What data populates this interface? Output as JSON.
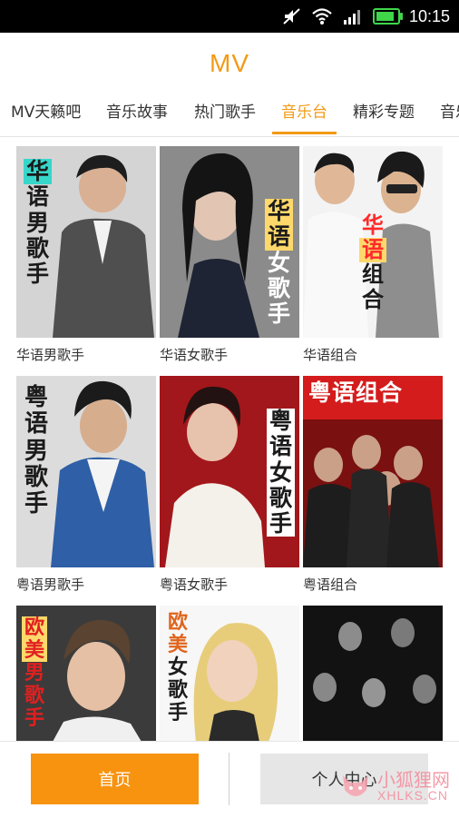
{
  "status_bar": {
    "time": "10:15",
    "icons": [
      "mute-icon",
      "wifi-icon",
      "signal-icon",
      "battery-icon"
    ],
    "battery_level": 0.9
  },
  "header": {
    "title": "MV"
  },
  "tabs": [
    {
      "label": "MV天籁吧",
      "active": false
    },
    {
      "label": "音乐故事",
      "active": false
    },
    {
      "label": "热门歌手",
      "active": false
    },
    {
      "label": "音乐台",
      "active": true
    },
    {
      "label": "精彩专题",
      "active": false
    },
    {
      "label": "音乐",
      "active": false
    }
  ],
  "grid": {
    "items": [
      {
        "label": "华语男歌手",
        "overlay": [
          "华",
          "语",
          "男",
          "歌",
          "手"
        ]
      },
      {
        "label": "华语女歌手",
        "overlay": [
          "华",
          "语",
          "女",
          "歌",
          "手"
        ]
      },
      {
        "label": "华语组合",
        "overlay": [
          "华",
          "语",
          "组",
          "合"
        ]
      },
      {
        "label": "粤语男歌手",
        "overlay": [
          "粤",
          "语",
          "男",
          "歌",
          "手"
        ]
      },
      {
        "label": "粤语女歌手",
        "overlay": [
          "粤",
          "语",
          "女",
          "歌",
          "手"
        ]
      },
      {
        "label": "粤语组合",
        "overlay": [
          "粤语组合"
        ]
      },
      {
        "label": "",
        "overlay": [
          "欧",
          "美",
          "男",
          "歌",
          "手"
        ]
      },
      {
        "label": "",
        "overlay": [
          "欧",
          "美",
          "女",
          "歌",
          "手"
        ]
      },
      {
        "label": "",
        "overlay": []
      }
    ]
  },
  "bottom_nav": {
    "home_label": "首页",
    "user_label": "个人中心"
  },
  "watermark": {
    "cn": "小狐狸网",
    "en": "XHLKS.CN"
  },
  "colors": {
    "accent": "#f39a16",
    "home_button": "#f7930e",
    "user_button": "#e6e6e6"
  }
}
